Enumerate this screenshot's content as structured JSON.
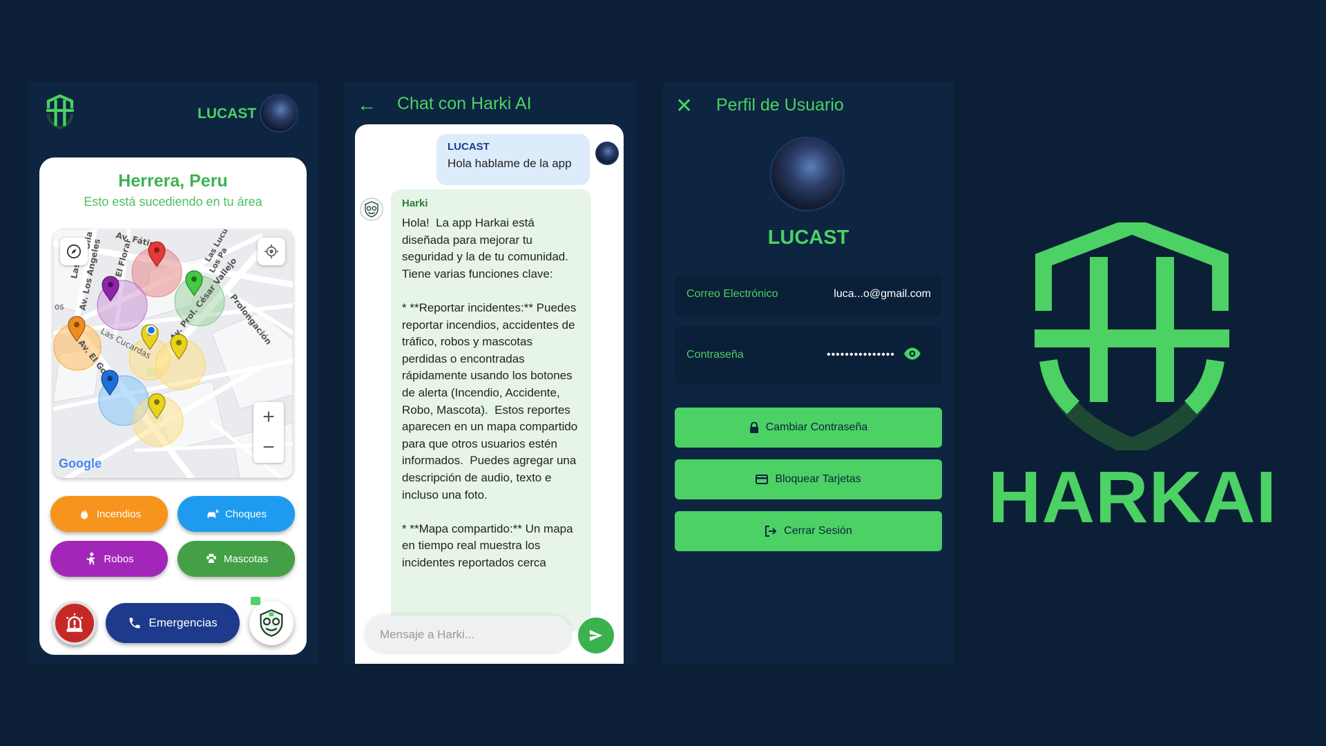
{
  "colors": {
    "background": "#0b1f36",
    "panel": "#0d2540",
    "accent": "#4cd164",
    "emergency": "#1d3a8c"
  },
  "home": {
    "username": "LUCAST",
    "location_title": "Herrera, Peru",
    "location_subtitle": "Esto está sucediendo en tu área",
    "map": {
      "streets": [
        "Av. Fátima",
        "El Floral",
        "Av. Los Angeles",
        "Las",
        "Olia",
        "Las Lucumas",
        "Los Pa",
        "Av. Prol. César Vallejo",
        "Prolongación",
        "Las Cucardas",
        "Av. El Golf",
        "os"
      ],
      "attribution": "Google",
      "zoom_in": "+",
      "zoom_out": "−"
    },
    "buttons": {
      "incendios": "Incendios",
      "choques": "Choques",
      "robos": "Robos",
      "mascotas": "Mascotas",
      "emergencias": "Emergencias"
    }
  },
  "chat": {
    "title": "Chat con Harki AI",
    "user_name": "LUCAST",
    "user_message": "Hola hablame de la app",
    "bot_name": "Harki",
    "bot_message": "Hola!  La app Harkai está diseñada para mejorar tu seguridad y la de tu comunidad.  Tiene varias funciones clave:\n\n* **Reportar incidentes:** Puedes reportar incendios, accidentes de tráfico, robos y mascotas perdidas o encontradas rápidamente usando los botones de alerta (Incendio, Accidente, Robo, Mascota).  Estos reportes aparecen en un mapa compartido para que otros usuarios estén informados.  Puedes agregar una descripción de audio, texto e incluso una foto.\n\n* **Mapa compartido:** Un mapa en tiempo real muestra los incidentes reportados cerca",
    "input_placeholder": "Mensaje a Harki..."
  },
  "profile": {
    "title": "Perfil de Usuario",
    "username": "LUCAST",
    "email_label": "Correo Electrónico",
    "email_value": "luca...o@gmail.com",
    "password_label": "Contraseña",
    "password_value": "•••••••••••••••",
    "buttons": {
      "change_password": "Cambiar Contraseña",
      "block_cards": "Bloquear Tarjetas",
      "logout": "Cerrar Sesión"
    }
  },
  "brand": {
    "name": "HARKAI"
  }
}
